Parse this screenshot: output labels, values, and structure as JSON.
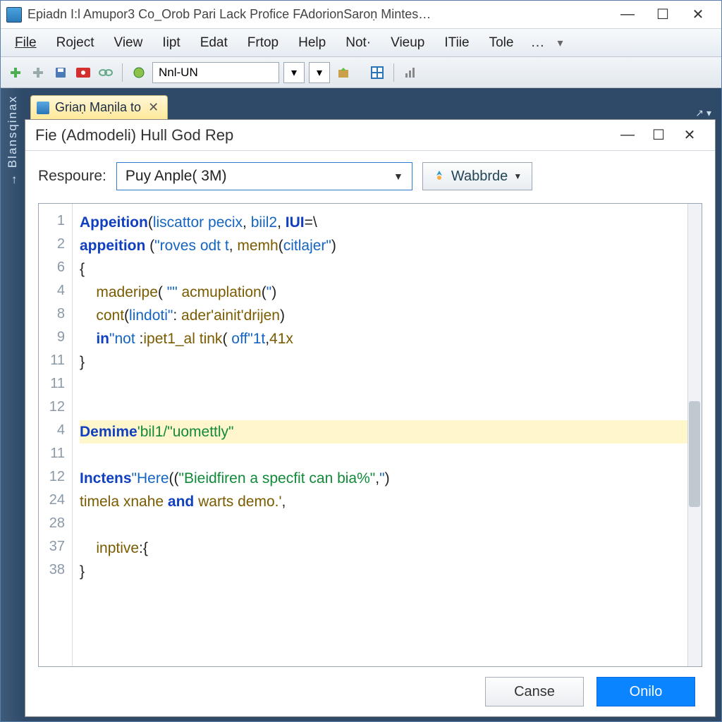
{
  "titlebar": {
    "text": "Epiadn I:l Amupor3 Co_Orob Pari Lack Profice FAdorionSaroṇ Mintes…"
  },
  "menu": {
    "items": [
      "File",
      "Roject",
      "View",
      "Iipt",
      "Edat",
      "Frtop",
      "Help",
      "Not·",
      "Vieup",
      "ITiie",
      "Tole"
    ],
    "overflow": "…"
  },
  "toolbar": {
    "combo_value": "Nnl-UN"
  },
  "sidebar": {
    "label": "→ Blansqinax"
  },
  "tab": {
    "label": "Griaṇ Maṇila to"
  },
  "subwindow": {
    "title": "Fie (Admodeli) Hull God Rep"
  },
  "params": {
    "label": "Respoure:",
    "value": "Puy Anple( 3M)",
    "action": "Wabbrde"
  },
  "editor": {
    "line_numbers": [
      "1",
      "2",
      "6",
      "4",
      "8",
      "9",
      "11",
      "11",
      "12",
      "4",
      "11",
      "12",
      "24",
      "28",
      "37",
      "38"
    ],
    "lines": [
      {
        "html": "<span class='k'>Appeition</span>(<span class='s'>liscattor pecix</span>, <span class='s'>biil2</span>, <span class='k'>IUI</span>=\\"
      },
      {
        "html": "<span class='k'>appeition</span> (<span class='s'>\"roves odt t</span>, <span class='n'>memh</span>(<span class='s'>citlajer\"</span>)"
      },
      {
        "html": "{"
      },
      {
        "html": "&nbsp;&nbsp;&nbsp;&nbsp;<span class='n'>maderipe</span>( <span class='s'>\"\"</span> <span class='n'>acmuplation</span>(<span class='s'>\"</span>)"
      },
      {
        "html": "&nbsp;&nbsp;&nbsp;&nbsp;<span class='n'>cont</span>(<span class='s'>lindoti\"</span>: <span class='n'>ader'ainit'drijen</span>)"
      },
      {
        "html": "&nbsp;&nbsp;&nbsp;&nbsp;<span class='k'>in</span><span class='s'>\"not</span> :<span class='n'>ipet1_al</span> <span class='n'>tink</span>( <span class='s'>off\"1t</span>,<span class='n'>41x</span>"
      },
      {
        "html": "}"
      },
      {
        "html": "&nbsp;"
      },
      {
        "html": "&nbsp;"
      },
      {
        "html": "<span class='hl'><span class='k'>Demime</span><span class='c'>'bil1/\"uomettly\"</span></span>"
      },
      {
        "html": "&nbsp;"
      },
      {
        "html": "<span class='k'>Inctens</span><span class='s'>\"Here</span>((<span class='c'>\"Bieidfiren a specfit can bia%\"</span>,<span class='s'>\"</span>)"
      },
      {
        "html": "<span class='n'>timela xnahe</span> <span class='k'>and</span> <span class='n'>warts demo.'</span>,"
      },
      {
        "html": "&nbsp;"
      },
      {
        "html": "&nbsp;&nbsp;&nbsp;&nbsp;<span class='n'>inptive</span>:{"
      },
      {
        "html": "}"
      }
    ]
  },
  "footer": {
    "cancel": "Canse",
    "ok": "Onilo"
  }
}
